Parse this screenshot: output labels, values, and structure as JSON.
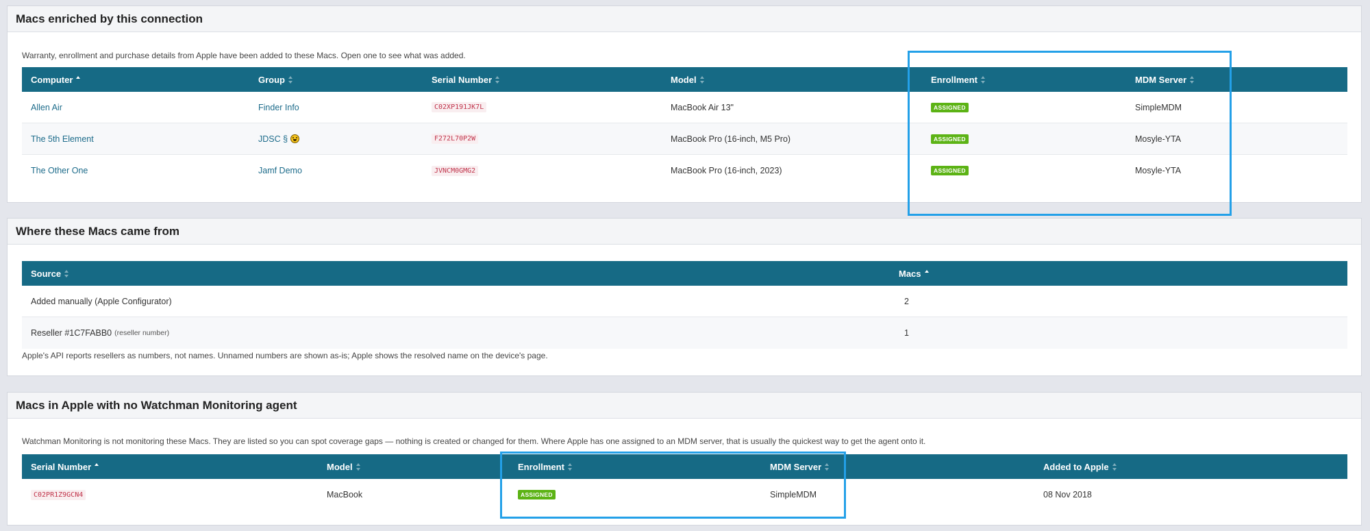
{
  "enriched": {
    "title": "Macs enriched by this connection",
    "description": "Warranty, enrollment and purchase details from Apple have been added to these Macs. Open one to see what was added.",
    "columns": [
      "Computer",
      "Group",
      "Serial Number",
      "Model",
      "Enrollment",
      "MDM Server"
    ],
    "rows": [
      {
        "computer": "Allen Air",
        "group": "Finder Info",
        "serial": "C02XP191JK7L",
        "model": "MacBook Air 13\"",
        "enrollment": "ASSIGNED",
        "mdm": "SimpleMDM"
      },
      {
        "computer": "The 5th Element",
        "group": "JDSC §",
        "serial": "F272L70P2W",
        "model": "MacBook Pro (16-inch, M5 Pro)",
        "enrollment": "ASSIGNED",
        "mdm": "Mosyle-YTA"
      },
      {
        "computer": "The Other One",
        "group": "Jamf Demo",
        "serial": "JVNCM0GMG2",
        "model": "MacBook Pro (16-inch, 2023)",
        "enrollment": "ASSIGNED",
        "mdm": "Mosyle-YTA"
      }
    ]
  },
  "sources": {
    "title": "Where these Macs came from",
    "columns": [
      "Source",
      "Macs"
    ],
    "rows": [
      {
        "source": "Added manually (Apple Configurator)",
        "note": "",
        "macs": "2"
      },
      {
        "source": "Reseller #1C7FABB0",
        "note": "(reseller number)",
        "macs": "1"
      }
    ],
    "footnote": "Apple's API reports resellers as numbers, not names. Unnamed numbers are shown as-is; Apple shows the resolved name on the device's page."
  },
  "unmonitored": {
    "title": "Macs in Apple with no Watchman Monitoring agent",
    "description": "Watchman Monitoring is not monitoring these Macs. They are listed so you can spot coverage gaps — nothing is created or changed for them. Where Apple has one assigned to an MDM server, that is usually the quickest way to get the agent onto it.",
    "columns": [
      "Serial Number",
      "Model",
      "Enrollment",
      "MDM Server",
      "Added to Apple"
    ],
    "rows": [
      {
        "serial": "C02PR1Z9GCN4",
        "model": "MacBook",
        "enrollment": "ASSIGNED",
        "mdm": "SimpleMDM",
        "added": "08 Nov 2018"
      }
    ]
  },
  "colors": {
    "header_bg": "#166a85",
    "badge_green": "#5cb315",
    "highlight_blue": "#23a0e8",
    "link": "#1c6b8a"
  }
}
